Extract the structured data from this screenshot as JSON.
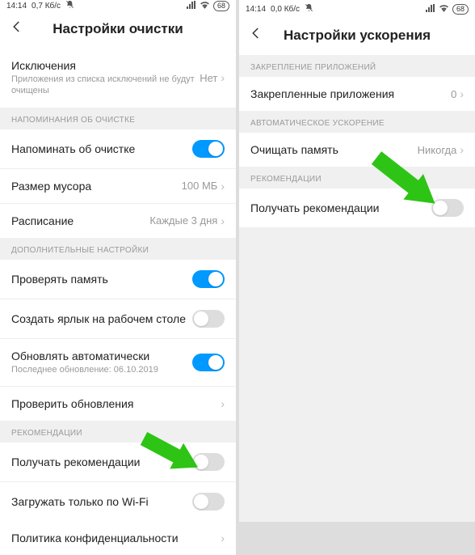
{
  "left": {
    "status": {
      "time": "14:14",
      "speed": "0,7 Кб/с",
      "battery": "68"
    },
    "title": "Настройки очистки",
    "exclusions": {
      "label": "Исключения",
      "sub": "Приложения из списка исключений не будут очищены",
      "value": "Нет"
    },
    "sec_reminders": "НАПОМИНАНИЯ ОБ ОЧИСТКЕ",
    "remind": {
      "label": "Напоминать об очистке"
    },
    "trash": {
      "label": "Размер мусора",
      "value": "100 МБ"
    },
    "schedule": {
      "label": "Расписание",
      "value": "Каждые 3 дня"
    },
    "sec_additional": "ДОПОЛНИТЕЛЬНЫЕ НАСТРОЙКИ",
    "checkmem": {
      "label": "Проверять память"
    },
    "shortcut": {
      "label": "Создать ярлык на рабочем столе"
    },
    "autoupd": {
      "label": "Обновлять автоматически",
      "sub": "Последнее обновление: 06.10.2019"
    },
    "checkupd": {
      "label": "Проверить обновления"
    },
    "sec_recs": "РЕКОМЕНДАЦИИ",
    "recs": {
      "label": "Получать рекомендации"
    },
    "wifi": {
      "label": "Загружать только по Wi-Fi"
    },
    "privacy": {
      "label": "Политика конфиденциальности"
    }
  },
  "right": {
    "status": {
      "time": "14:14",
      "speed": "0,0 Кб/с",
      "battery": "68"
    },
    "title": "Настройки ускорения",
    "sec_pinned": "ЗАКРЕПЛЕНИЕ ПРИЛОЖЕНИЙ",
    "pinned": {
      "label": "Закрепленные приложения",
      "value": "0"
    },
    "sec_auto": "АВТОМАТИЧЕСКОЕ УСКОРЕНИЕ",
    "clearmem": {
      "label": "Очищать память",
      "value": "Никогда"
    },
    "sec_recs": "РЕКОМЕНДАЦИИ",
    "recs": {
      "label": "Получать рекомендации"
    }
  }
}
